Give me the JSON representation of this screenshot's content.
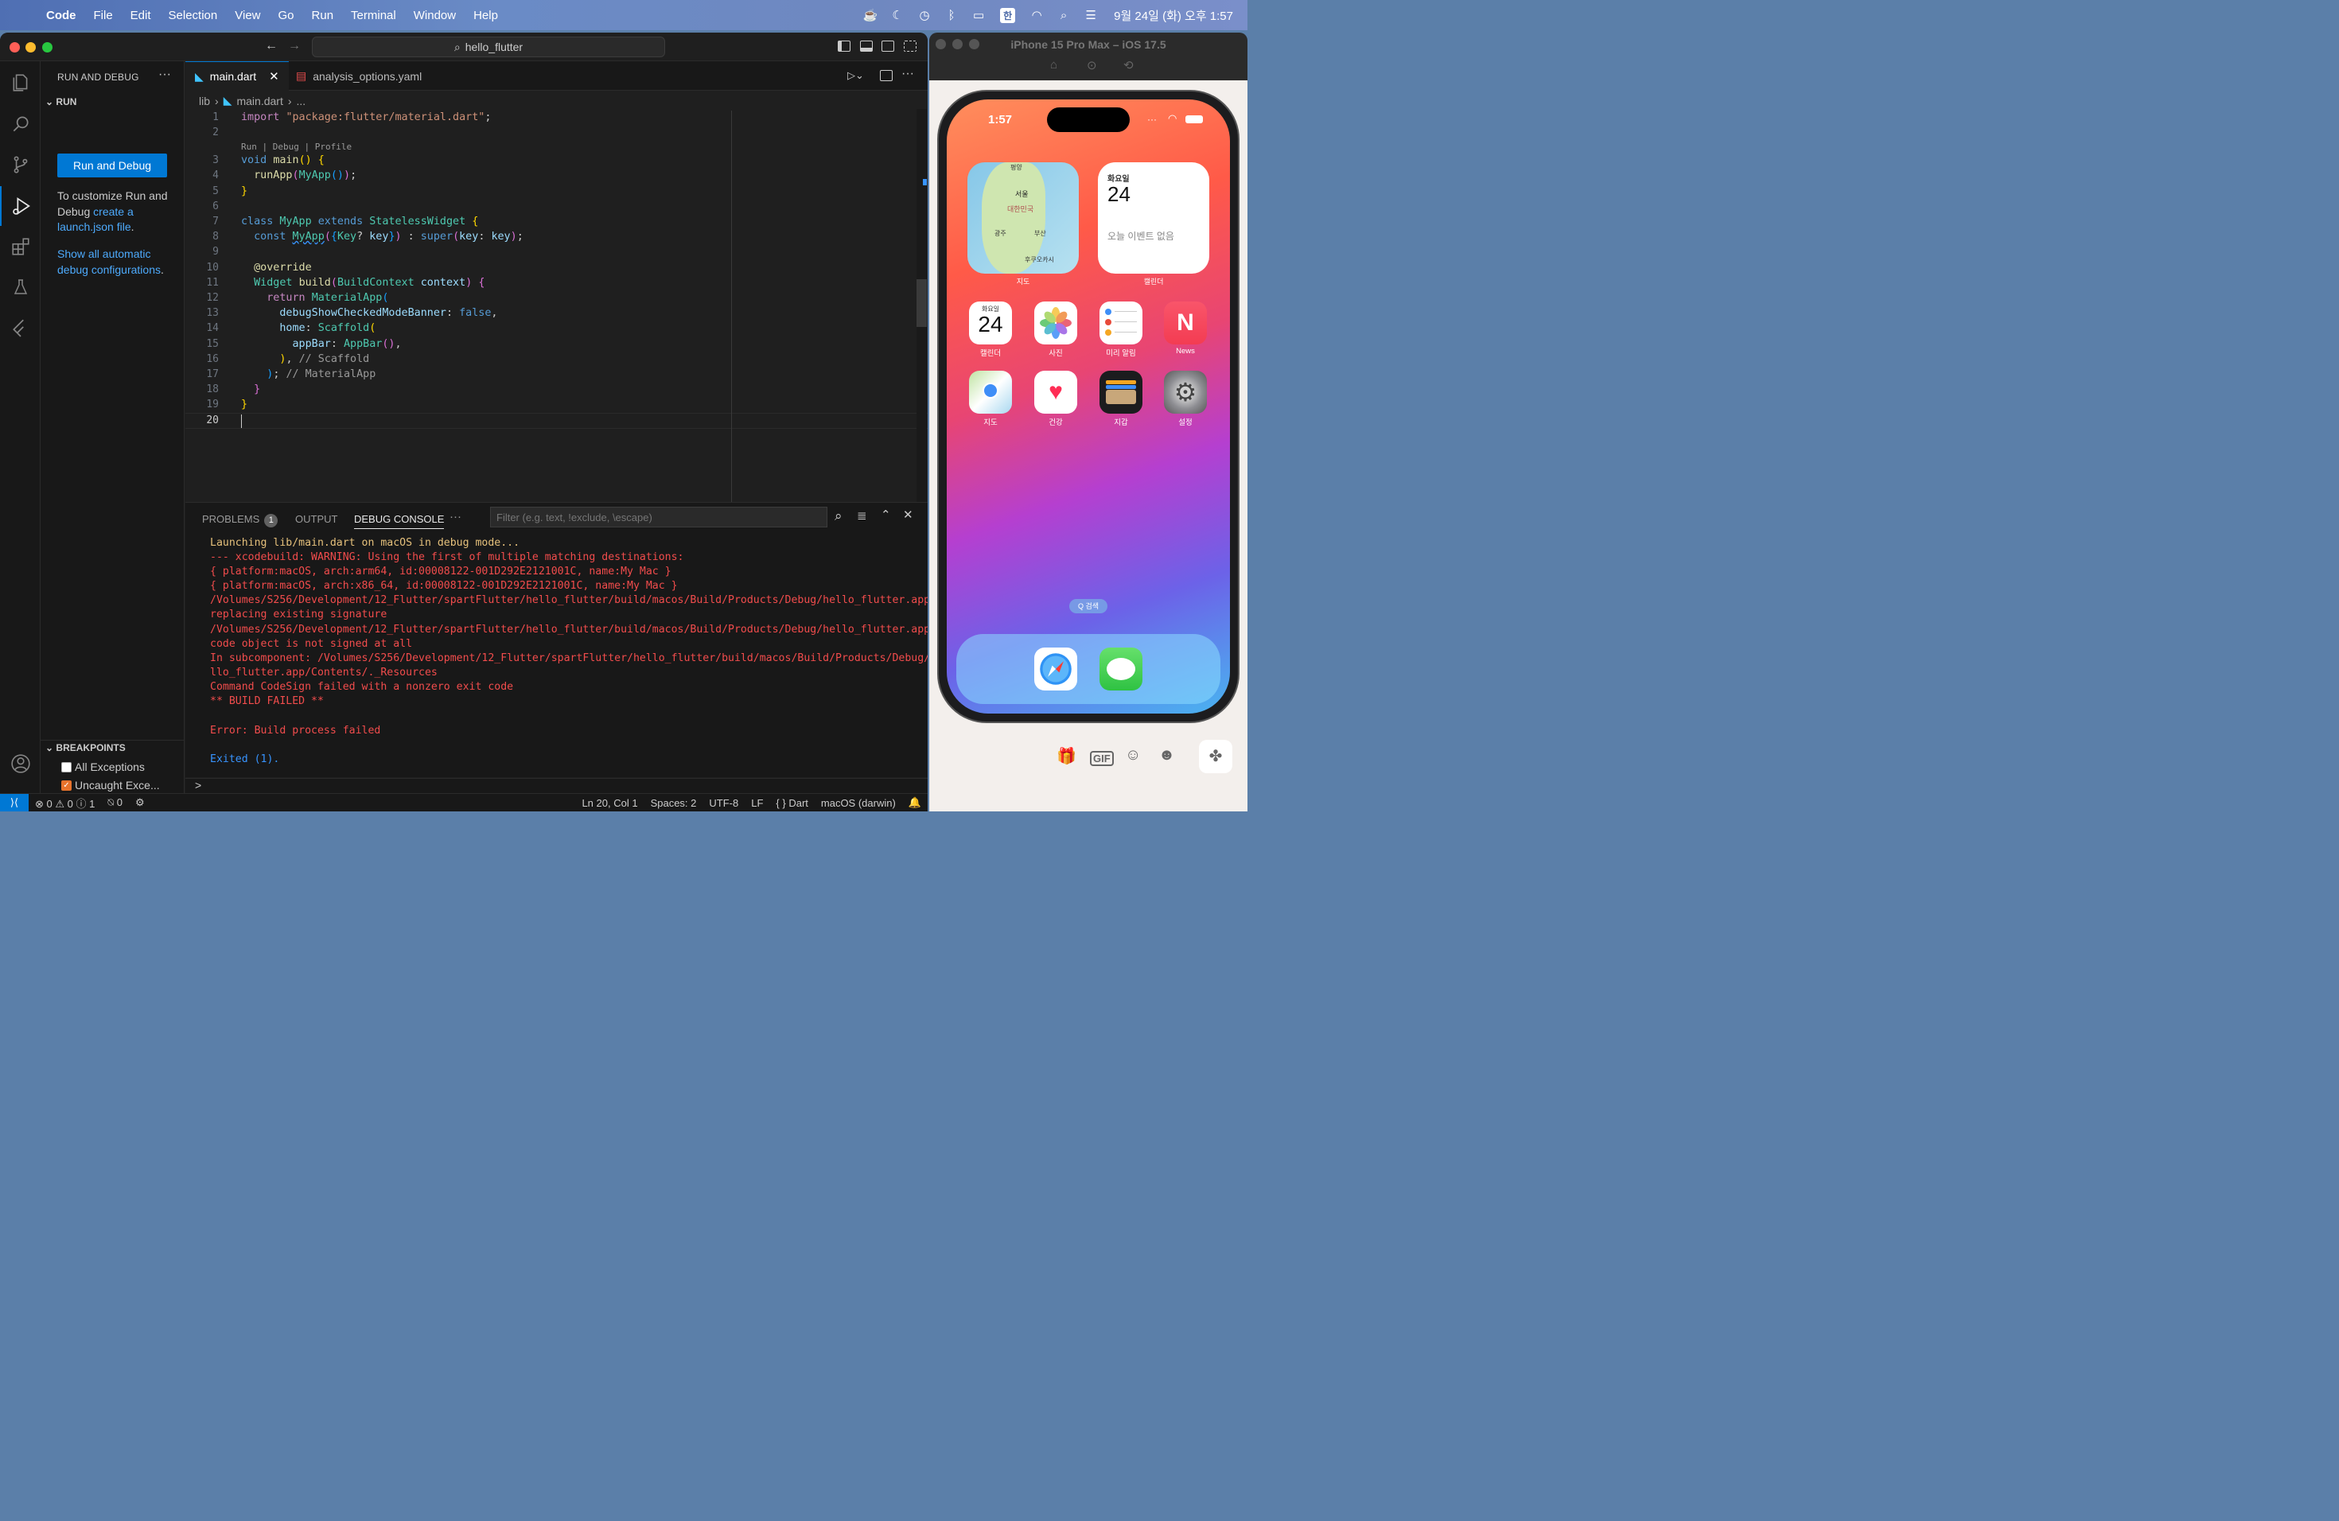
{
  "menubar": {
    "app_name": "Code",
    "items": [
      "File",
      "Edit",
      "Selection",
      "View",
      "Go",
      "Run",
      "Terminal",
      "Window",
      "Help"
    ],
    "ime_label": "한",
    "clock": "9월 24일 (화) 오후 1:57"
  },
  "title": {
    "search_text": "hello_flutter"
  },
  "sidebar": {
    "header": "RUN AND DEBUG",
    "run_section": "RUN",
    "run_button": "Run and Debug",
    "info_text_1": "To customize Run and Debug",
    "info_link": "create a launch.json file",
    "info_period": ".",
    "show_link": "Show all automatic debug configurations",
    "breakpoints_section": "BREAKPOINTS",
    "breakpoints": [
      {
        "label": "All Exceptions",
        "checked": false
      },
      {
        "label": "Uncaught Exce...",
        "checked": true
      }
    ]
  },
  "editor": {
    "tabs": [
      {
        "label": "main.dart",
        "active": true
      },
      {
        "label": "analysis_options.yaml",
        "active": false
      }
    ],
    "breadcrumb": [
      "lib",
      "main.dart",
      "..."
    ],
    "codelens": "Run | Debug | Profile",
    "line_numbers": [
      "1",
      "2",
      "3",
      "4",
      "5",
      "6",
      "7",
      "8",
      "9",
      "10",
      "11",
      "12",
      "13",
      "14",
      "15",
      "16",
      "17",
      "18",
      "19",
      "20"
    ]
  },
  "panel": {
    "tabs": [
      "PROBLEMS",
      "OUTPUT",
      "DEBUG CONSOLE"
    ],
    "problems_count": "1",
    "filter_placeholder": "Filter (e.g. text, !exclude, \\escape)",
    "output": [
      {
        "text": "Launching lib/main.dart on macOS in debug mode...",
        "kind": "info"
      },
      {
        "text": "--- xcodebuild: WARNING: Using the first of multiple matching destinations:",
        "kind": "err"
      },
      {
        "text": "{ platform:macOS, arch:arm64, id:00008122-001D292E2121001C, name:My Mac }",
        "kind": "err"
      },
      {
        "text": "{ platform:macOS, arch:x86_64, id:00008122-001D292E2121001C, name:My Mac }",
        "kind": "err"
      },
      {
        "text": "/Volumes/S256/Development/12_Flutter/spartFlutter/hello_flutter/build/macos/Build/Products/Debug/hello_flutter.app:",
        "kind": "err"
      },
      {
        "text": "replacing existing signature",
        "kind": "err"
      },
      {
        "text": "/Volumes/S256/Development/12_Flutter/spartFlutter/hello_flutter/build/macos/Build/Products/Debug/hello_flutter.app:",
        "kind": "err"
      },
      {
        "text": "code object is not signed at all",
        "kind": "err"
      },
      {
        "text": "In subcomponent: /Volumes/S256/Development/12_Flutter/spartFlutter/hello_flutter/build/macos/Build/Products/Debug/he",
        "kind": "err"
      },
      {
        "text": "llo_flutter.app/Contents/._Resources",
        "kind": "err"
      },
      {
        "text": "Command CodeSign failed with a nonzero exit code",
        "kind": "err"
      },
      {
        "text": "** BUILD FAILED **",
        "kind": "err"
      },
      {
        "text": "",
        "kind": "err"
      },
      {
        "text": "Error: Build process failed",
        "kind": "err"
      },
      {
        "text": "",
        "kind": "err"
      },
      {
        "text": "Exited (1).",
        "kind": "exit"
      }
    ],
    "prompt": ">"
  },
  "statusbar": {
    "errors": "0",
    "warnings": "0",
    "infos": "1",
    "ports": "0",
    "position": "Ln 20, Col 1",
    "spaces": "Spaces: 2",
    "encoding": "UTF-8",
    "eol": "LF",
    "language": "Dart",
    "device": "macOS (darwin)"
  },
  "simulator": {
    "title": "iPhone 15 Pro Max – iOS 17.5",
    "time": "1:57",
    "map_labels": [
      "평양",
      "서울",
      "대한민국",
      "광주",
      "부산",
      "후쿠오카시"
    ],
    "widget_map_label": "지도",
    "calendar_widget": {
      "weekday": "화요일",
      "day": "24",
      "empty": "오늘 이벤트 없음",
      "label": "캘린더"
    },
    "apps_row1": [
      {
        "label": "캘린더",
        "icon": "calendar-icon",
        "weekday": "화요일",
        "day": "24"
      },
      {
        "label": "사진",
        "icon": "photos-icon"
      },
      {
        "label": "미리 알림",
        "icon": "reminders-icon"
      },
      {
        "label": "News",
        "icon": "news-icon"
      }
    ],
    "apps_row2": [
      {
        "label": "지도",
        "icon": "maps-icon"
      },
      {
        "label": "건강",
        "icon": "health-icon"
      },
      {
        "label": "지갑",
        "icon": "wallet-icon"
      },
      {
        "label": "설정",
        "icon": "settings-icon"
      }
    ],
    "search_pill": "Q 검색",
    "dock": [
      "safari-icon",
      "messages-icon"
    ]
  },
  "colors": {
    "accent": "#0078d4",
    "error": "#f14c4c",
    "info": "#e5c07b"
  }
}
